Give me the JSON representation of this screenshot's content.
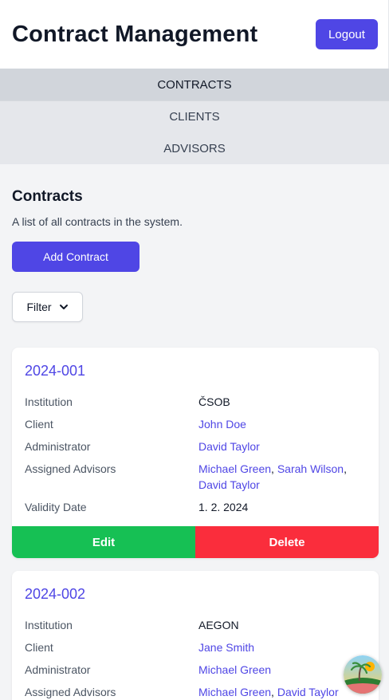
{
  "header": {
    "title": "Contract Management",
    "logout_label": "Logout"
  },
  "nav": {
    "items": [
      {
        "label": "CONTRACTS",
        "active": true
      },
      {
        "label": "CLIENTS",
        "active": false
      },
      {
        "label": "ADVISORS",
        "active": false
      }
    ]
  },
  "main": {
    "title": "Contracts",
    "description": "A list of all contracts in the system.",
    "add_label": "Add Contract",
    "filter_label": "Filter"
  },
  "labels": {
    "institution": "Institution",
    "client": "Client",
    "administrator": "Administrator",
    "advisors": "Assigned Advisors",
    "validity": "Validity Date",
    "edit": "Edit",
    "delete": "Delete"
  },
  "contracts": [
    {
      "number": "2024-001",
      "institution": "ČSOB",
      "client": "John Doe",
      "administrator": "David Taylor",
      "advisors": [
        "Michael Green",
        "Sarah Wilson",
        "David Taylor"
      ],
      "validity": "1. 2. 2024"
    },
    {
      "number": "2024-002",
      "institution": "AEGON",
      "client": "Jane Smith",
      "administrator": "Michael Green",
      "advisors": [
        "Michael Green",
        "David Taylor"
      ]
    }
  ],
  "colors": {
    "primary": "#4f46e5",
    "edit": "#16c054",
    "delete": "#fa2d3c",
    "background": "#f3f4f6"
  },
  "icons": {
    "filter": "chevron-down-icon",
    "fab": "island-avatar-icon"
  }
}
